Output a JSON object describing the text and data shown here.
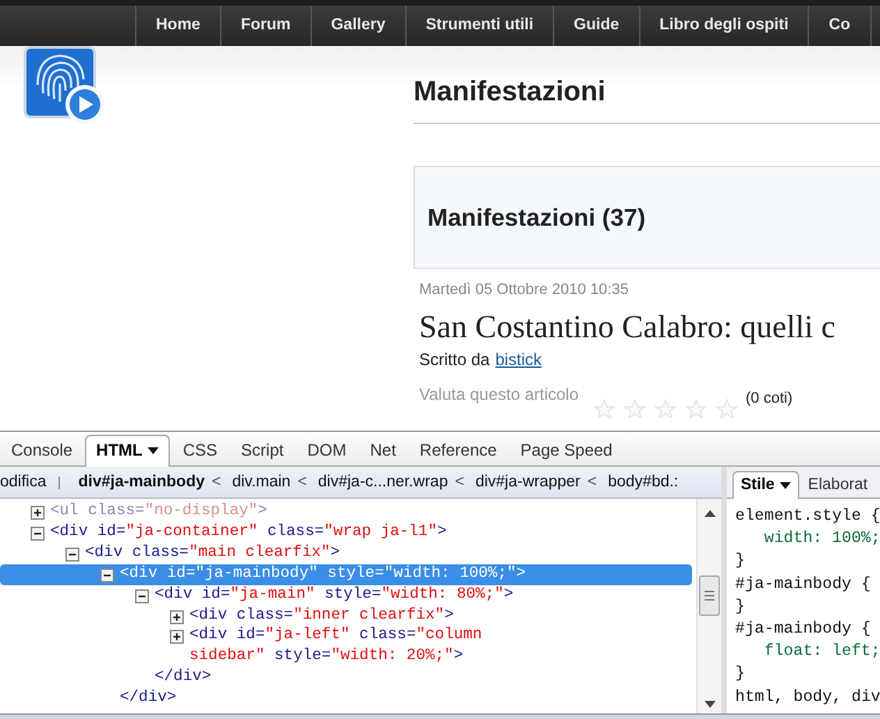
{
  "nav": {
    "items": [
      "Home",
      "Forum",
      "Gallery",
      "Strumenti utili",
      "Guide",
      "Libro degli ospiti",
      "Co"
    ]
  },
  "page": {
    "title": "Manifestazioni",
    "category_heading": "Manifestazioni (37)",
    "article": {
      "date": "Martedì 05 Ottobre 2010 10:35",
      "headline": "San Costantino Calabro: quelli c",
      "byline": "Scritto da",
      "author": "bistick",
      "rating_label": "Valuta questo articolo",
      "stars": 0,
      "votes": "(0 coti)"
    }
  },
  "devtools": {
    "tabs": [
      {
        "label": "Console",
        "selected": false,
        "dropdown": false
      },
      {
        "label": "HTML",
        "selected": true,
        "dropdown": true
      },
      {
        "label": "CSS",
        "selected": false,
        "dropdown": false
      },
      {
        "label": "Script",
        "selected": false,
        "dropdown": false
      },
      {
        "label": "DOM",
        "selected": false,
        "dropdown": false
      },
      {
        "label": "Net",
        "selected": false,
        "dropdown": false
      },
      {
        "label": "Reference",
        "selected": false,
        "dropdown": false
      },
      {
        "label": "Page Speed",
        "selected": false,
        "dropdown": false
      }
    ],
    "edit_button": "odifica",
    "breadcrumbs": [
      {
        "label": "div#ja-mainbody",
        "selected": true,
        "separator": "<"
      },
      {
        "label": "div.main",
        "selected": false,
        "separator": "<"
      },
      {
        "label": "div#ja-c...ner.wrap",
        "selected": false,
        "separator": "<"
      },
      {
        "label": "div#ja-wrapper",
        "selected": false,
        "separator": "<"
      },
      {
        "label": "body#bd.:",
        "selected": false
      }
    ],
    "tree": [
      {
        "open": "<ul",
        "attrs": [
          {
            "name": "class=",
            "value": "\"no-display\""
          }
        ],
        "end": ">",
        "expanded": false,
        "hidden": true,
        "selected": false
      },
      {
        "open": "<div",
        "attrs": [
          {
            "name": "id=",
            "value": "\"ja-container\""
          },
          {
            "name": "class=",
            "value": "\"wrap ja-l1\""
          }
        ],
        "end": ">",
        "expanded": true,
        "hidden": false,
        "selected": false,
        "children": [
          {
            "open": "<div",
            "attrs": [
              {
                "name": "class=",
                "value": "\"main clearfix\""
              }
            ],
            "end": ">",
            "expanded": true,
            "hidden": false,
            "selected": false,
            "children": [
              {
                "open": "<div",
                "attrs": [
                  {
                    "name": "id=",
                    "value": "\"ja-mainbody\""
                  },
                  {
                    "name": "style=",
                    "value": "\"width: 100%;\""
                  }
                ],
                "end": ">",
                "expanded": true,
                "hidden": false,
                "selected": true,
                "closing": "</div>",
                "children": [
                  {
                    "open": "<div",
                    "attrs": [
                      {
                        "name": "id=",
                        "value": "\"ja-main\""
                      },
                      {
                        "name": "style=",
                        "value": "\"width: 80%;\""
                      }
                    ],
                    "end": ">",
                    "expanded": true,
                    "hidden": false,
                    "selected": false,
                    "closing": "</div>",
                    "children": [
                      {
                        "open": "<div",
                        "attrs": [
                          {
                            "name": "class=",
                            "value": "\"inner clearfix\""
                          }
                        ],
                        "end": ">",
                        "expanded": false,
                        "hidden": false,
                        "selected": false
                      },
                      {
                        "open": "<div",
                        "attrs": [
                          {
                            "name": "id=",
                            "value": "\"ja-left\""
                          },
                          {
                            "name": "class=",
                            "value": "\"column sidebar\""
                          },
                          {
                            "name": "style=",
                            "value": "\"width: 20%;\""
                          }
                        ],
                        "end": ">",
                        "expanded": false,
                        "hidden": false,
                        "selected": false
                      }
                    ]
                  }
                ]
              }
            ]
          }
        ]
      }
    ],
    "side_tabs": [
      {
        "label": "Stile",
        "selected": true,
        "dropdown": true
      },
      {
        "label": "Elaborat",
        "selected": false,
        "dropdown": false
      }
    ],
    "style_lines": [
      {
        "kind": "selector",
        "text": "element.style {"
      },
      {
        "kind": "declaration",
        "text": "width: 100%;"
      },
      {
        "kind": "brace",
        "text": "}"
      },
      {
        "kind": "selector",
        "text": "#ja-mainbody {"
      },
      {
        "kind": "brace",
        "text": "}"
      },
      {
        "kind": "selector",
        "text": "#ja-mainbody {"
      },
      {
        "kind": "declaration",
        "text": "float: left;"
      },
      {
        "kind": "brace",
        "text": "}"
      },
      {
        "kind": "selector",
        "text": "html, body, div"
      }
    ]
  }
}
